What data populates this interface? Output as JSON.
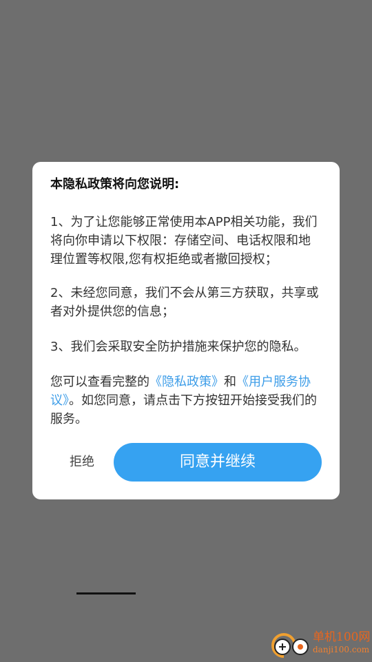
{
  "dialog": {
    "title": "本隐私政策将向您说明:",
    "paragraph_1": "1、为了让您能够正常使用本APP相关功能，我们将向你申请以下权限：存储空间、电话权限和地理位置等权限,您有权拒绝或者撤回授权；",
    "paragraph_2": "2、未经您同意，我们不会从第三方获取，共享或者对外提供您的信息；",
    "paragraph_3": "3、我们会采取安全防护措施来保护您的隐私。",
    "paragraph_4": {
      "prefix": "您可以查看完整的",
      "privacy_link": "《隐私政策》",
      "connector": "和",
      "agreement_link": "《用户服务协议》",
      "suffix": "。如您同意，请点击下方按钮开始接受我们的服务。"
    },
    "reject_label": "拒绝",
    "agree_label": "同意并继续"
  },
  "watermark": {
    "name": "单机100网",
    "url": "danji100.com"
  },
  "colors": {
    "overlay": "#6e6e6e",
    "accent": "#36a2f1",
    "link": "#3d9de8",
    "watermark": "#e8661e"
  }
}
